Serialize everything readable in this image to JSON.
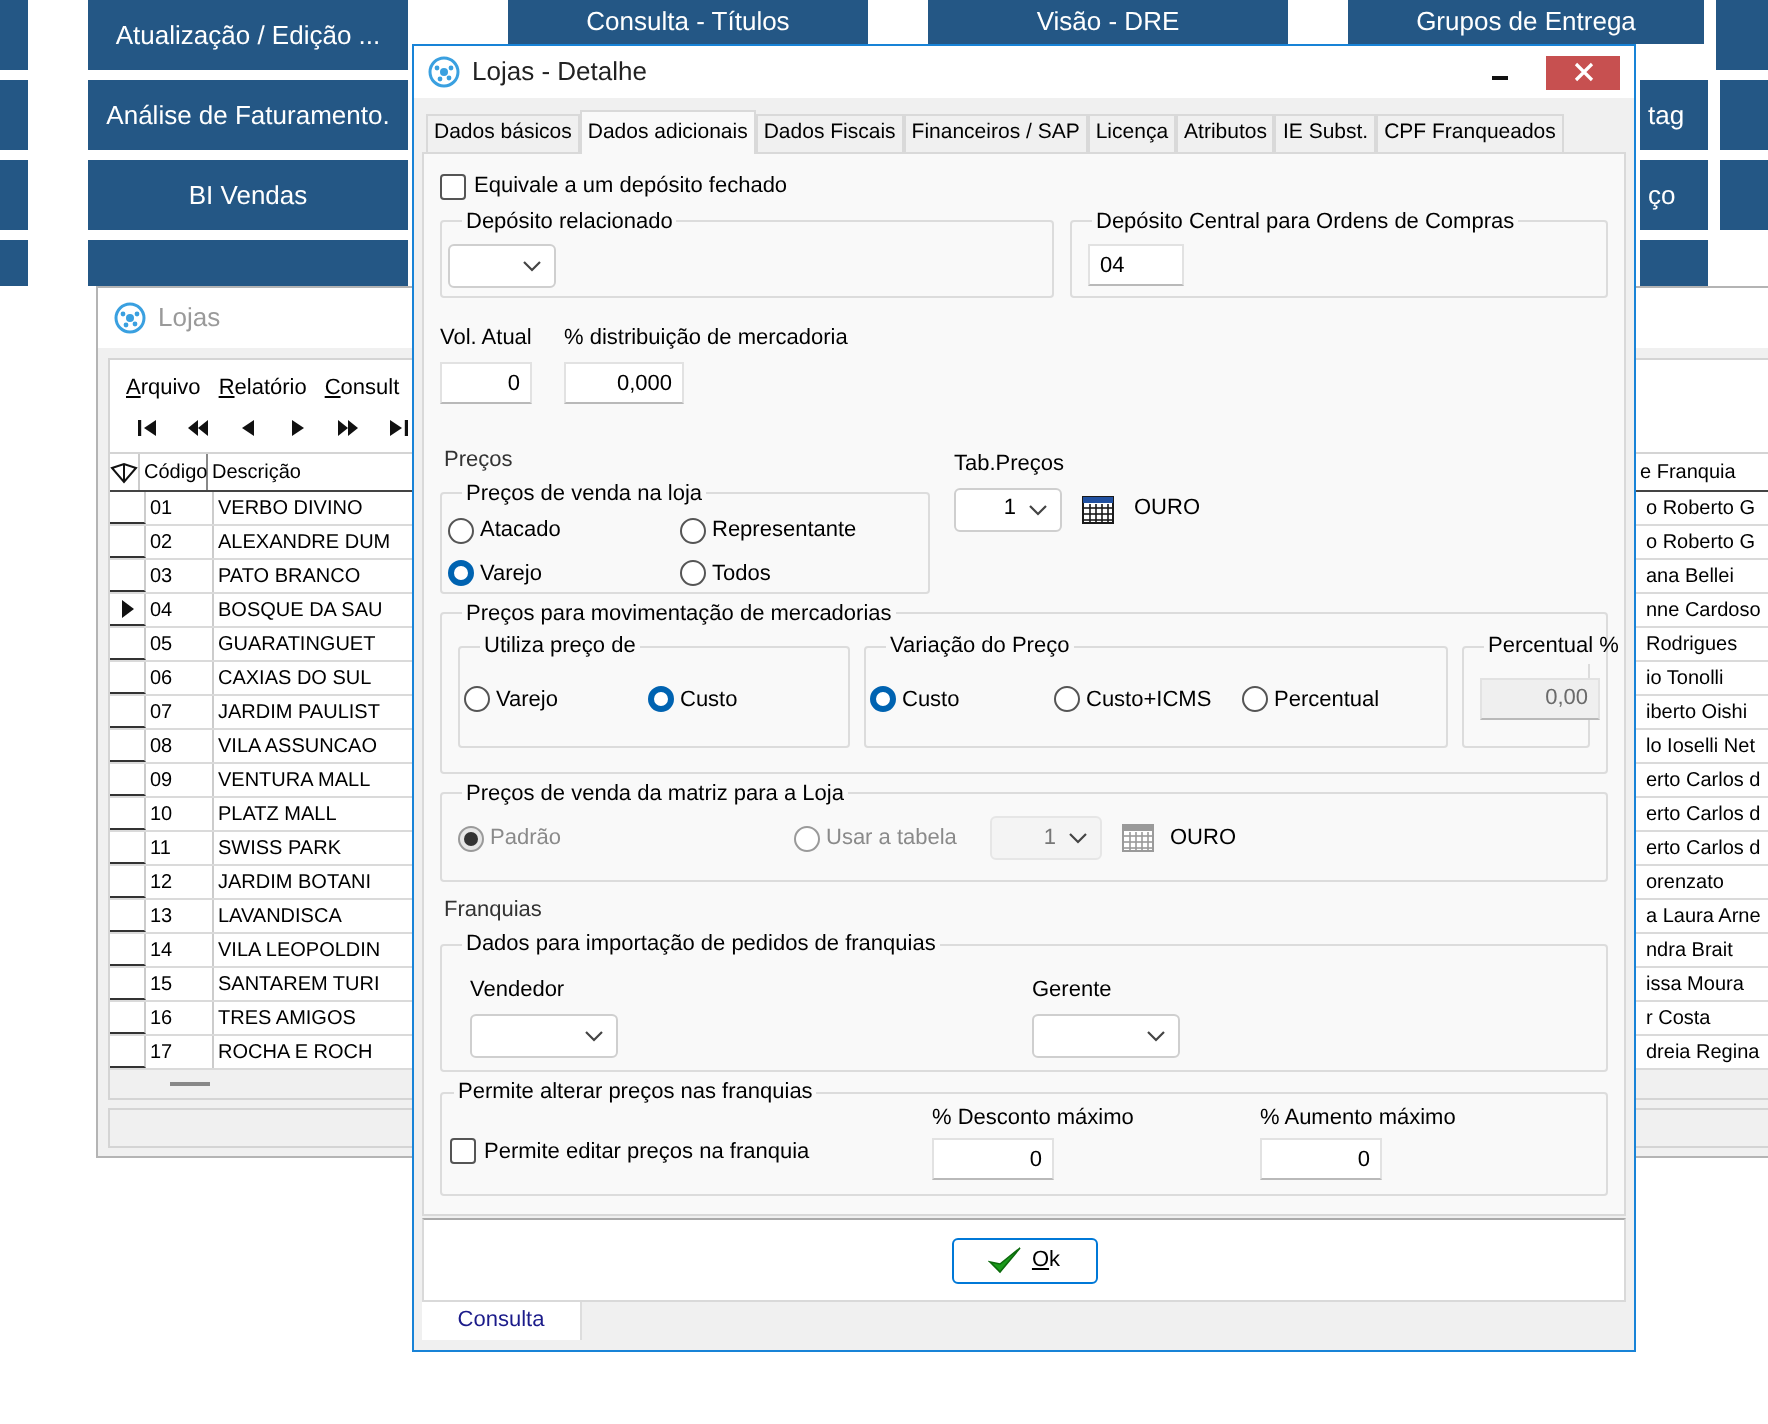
{
  "desktop": {
    "rows": [
      {
        "tiles": [
          {
            "kind": "blank"
          },
          {
            "kind": "full",
            "label": "Atualização / Edição ..."
          },
          {
            "kind": "full",
            "label": "Consulta - Títulos"
          },
          {
            "kind": "full",
            "label": "Visão - DRE"
          },
          {
            "kind": "full",
            "label": "Grupos de Entrega"
          },
          {
            "kind": "blank"
          }
        ]
      },
      {
        "tiles": [
          {
            "kind": "blank"
          },
          {
            "kind": "full",
            "label": "Análise de Faturamento."
          },
          {
            "kind": "cut",
            "label": "tag"
          },
          {
            "kind": "blank"
          }
        ]
      },
      {
        "tiles": [
          {
            "kind": "blank"
          },
          {
            "kind": "full",
            "label": "BI Vendas"
          },
          {
            "kind": "cut",
            "label": "ço"
          },
          {
            "kind": "blank"
          }
        ]
      },
      {
        "tiles": [
          {
            "kind": "blank"
          },
          {
            "kind": "blank"
          },
          {
            "kind": "blank"
          }
        ]
      }
    ]
  },
  "lojas_window": {
    "title": "Lojas",
    "menu": [
      "Arquivo",
      "Relatório",
      "Consult"
    ],
    "columns": [
      "Código",
      "Descrição",
      "e Franquia"
    ],
    "rows": [
      {
        "code": "01",
        "description": "VERBO DIVINO",
        "franchise": "o Roberto G",
        "selected": false
      },
      {
        "code": "02",
        "description": "ALEXANDRE DUM",
        "franchise": "o Roberto G",
        "selected": false
      },
      {
        "code": "03",
        "description": "PATO BRANCO",
        "franchise": "ana Bellei",
        "selected": false
      },
      {
        "code": "04",
        "description": "BOSQUE DA SAU",
        "franchise": "nne Cardoso",
        "selected": true
      },
      {
        "code": "05",
        "description": "GUARATINGUET",
        "franchise": "Rodrigues",
        "selected": false
      },
      {
        "code": "06",
        "description": "CAXIAS DO SUL",
        "franchise": "io Tonolli",
        "selected": false
      },
      {
        "code": "07",
        "description": "JARDIM PAULIST",
        "franchise": "iberto Oishi",
        "selected": false
      },
      {
        "code": "08",
        "description": "VILA ASSUNCAO",
        "franchise": "lo Ioselli Net",
        "selected": false
      },
      {
        "code": "09",
        "description": "VENTURA MALL",
        "franchise": "erto Carlos d",
        "selected": false
      },
      {
        "code": "10",
        "description": "PLATZ MALL",
        "franchise": "erto Carlos d",
        "selected": false
      },
      {
        "code": "11",
        "description": "SWISS PARK",
        "franchise": "erto Carlos d",
        "selected": false
      },
      {
        "code": "12",
        "description": "JARDIM BOTANI",
        "franchise": "orenzato",
        "selected": false
      },
      {
        "code": "13",
        "description": "LAVANDISCA",
        "franchise": "a Laura Arne",
        "selected": false
      },
      {
        "code": "14",
        "description": "VILA LEOPOLDIN",
        "franchise": "ndra Brait",
        "selected": false
      },
      {
        "code": "15",
        "description": "SANTAREM TURI",
        "franchise": "issa Moura",
        "selected": false
      },
      {
        "code": "16",
        "description": "TRES AMIGOS",
        "franchise": "r Costa",
        "selected": false
      },
      {
        "code": "17",
        "description": "ROCHA E ROCH",
        "franchise": "dreia Regina",
        "selected": false
      }
    ]
  },
  "dialog": {
    "title": "Lojas - Detalhe",
    "tabs": [
      {
        "label": "Dados básicos",
        "selected": false
      },
      {
        "label": "Dados adicionais",
        "selected": true
      },
      {
        "label": "Dados Fiscais",
        "selected": false
      },
      {
        "label": "Financeiros / SAP",
        "selected": false
      },
      {
        "label": "Licença",
        "selected": false
      },
      {
        "label": "Atributos",
        "selected": false
      },
      {
        "label": "IE Subst.",
        "selected": false
      },
      {
        "label": "CPF Franqueados",
        "selected": false
      }
    ],
    "closed_deposit": {
      "label": "Equivale a um depósito fechado",
      "checked": false
    },
    "related_deposit": {
      "title": "Depósito relacionado"
    },
    "central_deposit": {
      "title": "Depósito Central para Ordens de Compras",
      "value": "04"
    },
    "volume": {
      "label": "Vol. Atual",
      "value": "0"
    },
    "distribution": {
      "label": "% distribuição de mercadoria",
      "value": "0,000"
    },
    "prices_label": "Preços",
    "store_prices": {
      "title": "Preços de venda na loja",
      "options": [
        {
          "label": "Atacado",
          "selected": false
        },
        {
          "label": "Representante",
          "selected": false
        },
        {
          "label": "Varejo",
          "selected": true
        },
        {
          "label": "Todos",
          "selected": false
        }
      ]
    },
    "price_table": {
      "label": "Tab.Preços",
      "value": "1",
      "name": "OURO"
    },
    "movement": {
      "title": "Preços para movimentação de mercadorias",
      "use_price": {
        "title": "Utiliza preço de",
        "options": [
          {
            "label": "Varejo",
            "selected": false
          },
          {
            "label": "Custo",
            "selected": true
          }
        ]
      },
      "variation": {
        "title": "Variação do Preço",
        "options": [
          {
            "label": "Custo",
            "selected": true
          },
          {
            "label": "Custo+ICMS",
            "selected": false
          },
          {
            "label": "Percentual",
            "selected": false
          }
        ]
      },
      "percent": {
        "title": "Percentual %",
        "value": "0,00",
        "disabled": true
      }
    },
    "matrix_prices": {
      "title": "Preços de venda da matriz para a Loja",
      "disabled": true,
      "options": [
        {
          "label": "Padrão",
          "selected": true
        },
        {
          "label": "Usar a tabela",
          "selected": false
        }
      ],
      "table_value": "1",
      "table_name": "OURO"
    },
    "franchises_label": "Franquias",
    "import": {
      "title": "Dados para importação de pedidos de franquias",
      "fields": [
        {
          "label": "Vendedor"
        },
        {
          "label": "Gerente"
        }
      ]
    },
    "price_change": {
      "title": "Permite alterar preços nas franquias",
      "checkbox": {
        "label": "Permite editar preços na franquia",
        "checked": false
      },
      "discount": {
        "label": "% Desconto máximo",
        "value": "0"
      },
      "increase": {
        "label": "% Aumento máximo",
        "value": "0"
      }
    },
    "ok_button": "Ok",
    "bottom_tab": "Consulta"
  }
}
